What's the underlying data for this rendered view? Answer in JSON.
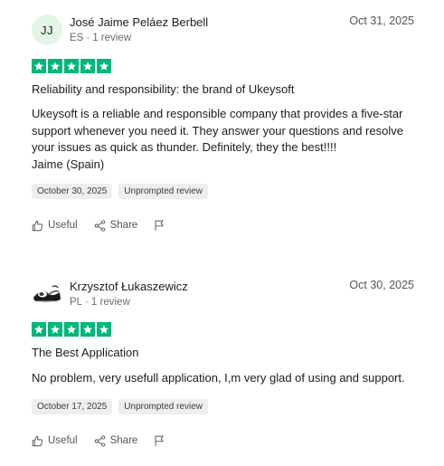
{
  "reviews": [
    {
      "avatar_initials": "JJ",
      "avatar_icon": "user-photo-icon",
      "name": "José Jaime Peláez Berbell",
      "country": "ES",
      "review_count": "1 review",
      "date": "Oct 31, 2025",
      "rating": 5,
      "title": "Reliability and responsibility: the brand of Ukeysoft",
      "body_lines": [
        "Ukeysoft is a reliable and responsible company that provides a five-star",
        "support whenever you need it. They answer your questions and resolve",
        "your issues as quick as thunder. Definitely, they the best!!!!",
        "Jaime (Spain)"
      ],
      "experience_date": "October 30, 2025",
      "tag": "Unprompted review",
      "useful_label": "Useful",
      "share_label": "Share"
    },
    {
      "avatar_initials": "",
      "avatar_icon": "user-photo-icon",
      "name": "Krzysztof Łukaszewicz",
      "country": "PL",
      "review_count": "1 review",
      "date": "Oct 30, 2025",
      "rating": 5,
      "title": "The Best Application",
      "body_lines": [
        "No problem, very usefull application, I,m very glad of using and support."
      ],
      "experience_date": "October 17, 2025",
      "tag": "Unprompted review",
      "useful_label": "Useful",
      "share_label": "Share"
    }
  ],
  "colors": {
    "star_green": "#00b67a",
    "avatar_bg": "#e3f6e6",
    "tag_bg": "#eeeeee"
  },
  "icons": [
    "star-icon",
    "thumbs-up-icon",
    "share-icon",
    "flag-icon"
  ]
}
